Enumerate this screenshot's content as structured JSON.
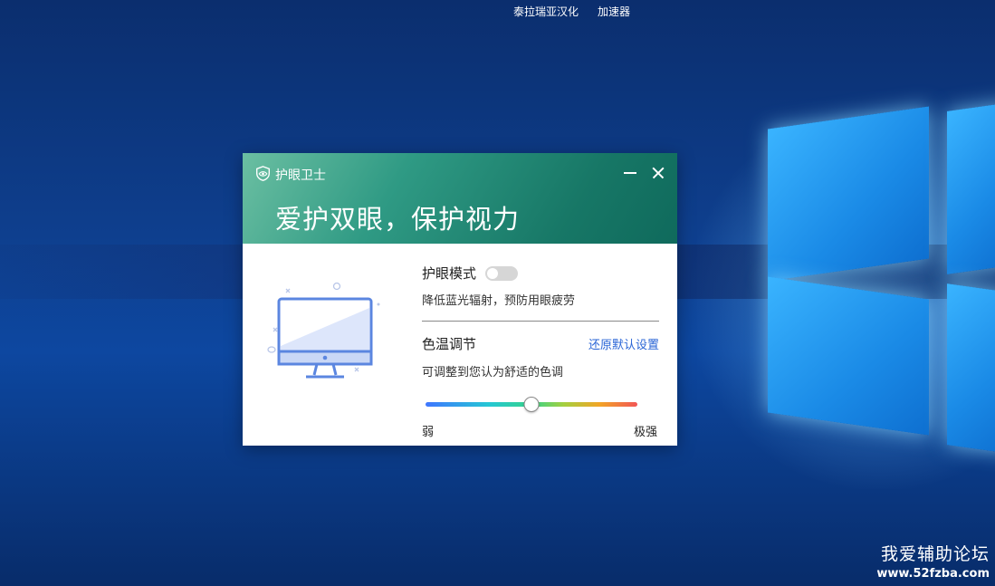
{
  "desktop": {
    "topbar": [
      "泰拉瑞亚汉化",
      "加速器"
    ],
    "watermark": {
      "title": "我爱辅助论坛",
      "url": "www.52fzba.com"
    }
  },
  "dialog": {
    "app_title": "护眼卫士",
    "app_icon": "eye-shield-icon",
    "slogan": "爱护双眼，保护视力",
    "eye_mode": {
      "label": "护眼模式",
      "enabled": false,
      "description": "降低蓝光辐射，预防用眼疲劳"
    },
    "color_temp": {
      "label": "色温调节",
      "reset_label": "还原默认设置",
      "description": "可调整到您认为舒适的色调",
      "value_fraction": 0.5,
      "min_label": "弱",
      "max_label": "极强"
    },
    "illustration_icon": "monitor-icon",
    "colors": {
      "header_start": "#6bbfa2",
      "header_end": "#0f6a5c",
      "link": "#2a65d6",
      "illustration": "#5b86e0"
    }
  }
}
